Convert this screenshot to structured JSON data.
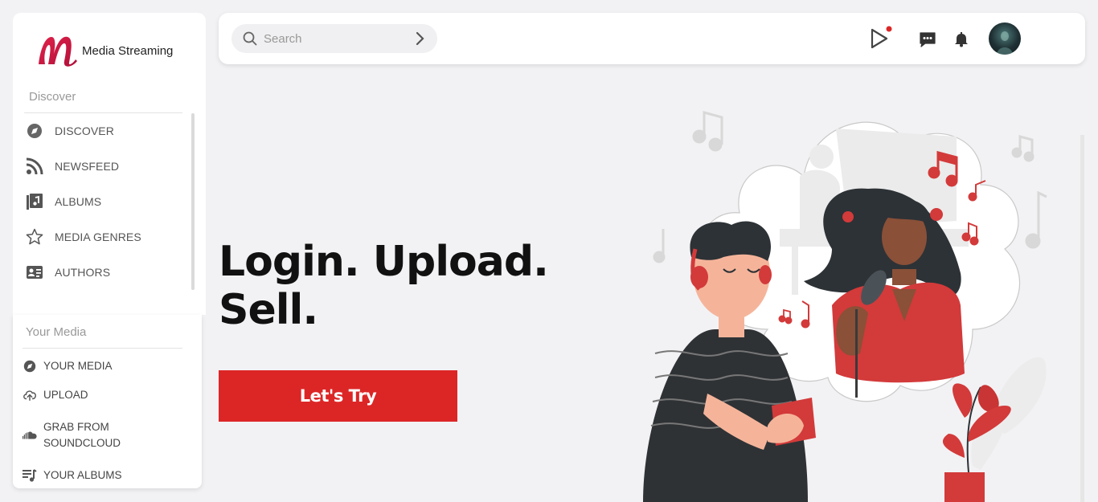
{
  "app": {
    "name": "Media Streaming"
  },
  "sidebar": {
    "discover_title": "Discover",
    "items": [
      {
        "label": "DISCOVER",
        "icon": "compass-icon"
      },
      {
        "label": "NEWSFEED",
        "icon": "rss-icon"
      },
      {
        "label": "ALBUMS",
        "icon": "album-icon"
      },
      {
        "label": "MEDIA GENRES",
        "icon": "star-icon"
      },
      {
        "label": "AUTHORS",
        "icon": "id-card-icon"
      }
    ],
    "your_media_title": "Your Media",
    "media_items": [
      {
        "label": "YOUR MEDIA",
        "icon": "compass-icon"
      },
      {
        "label": "UPLOAD",
        "icon": "cloud-upload-icon"
      },
      {
        "label": "GRAB FROM SOUNDCLOUD",
        "label_line1": "GRAB FROM",
        "label_line2": "SOUNDCLOUD",
        "icon": "soundcloud-icon"
      },
      {
        "label": "YOUR ALBUMS",
        "icon": "playlist-icon"
      }
    ]
  },
  "header": {
    "search_placeholder": "Search",
    "icons": [
      "play-icon",
      "chat-icon",
      "bell-icon",
      "avatar"
    ],
    "notification_dot_color": "#dc2626"
  },
  "hero": {
    "title_line1": "Login. Upload.",
    "title_line2": "Sell.",
    "cta_label": "Let's Try"
  },
  "colors": {
    "accent": "#dc2626",
    "background": "#f2f2f4"
  }
}
